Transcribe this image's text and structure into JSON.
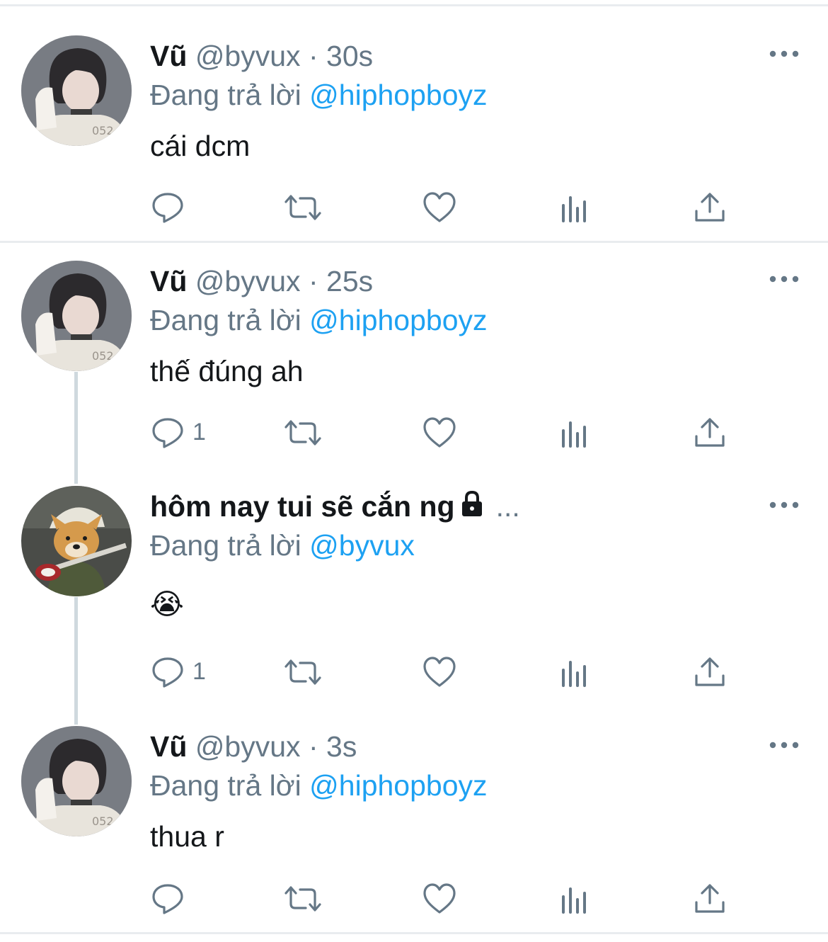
{
  "colors": {
    "accent": "#1da1f2",
    "secondary_text": "#657786",
    "primary_text": "#14171a",
    "divider": "#e9ecef",
    "thread_line": "#cfd9de"
  },
  "reply_prefix": "Đang trả lời",
  "tweets": [
    {
      "display_name": "Vũ",
      "handle": "@byvux",
      "separator": "·",
      "time": "30s",
      "reply_to": "@hiphopboyz",
      "text": "cái dcm",
      "reply_count": "",
      "avatar": "avatar-photo-person"
    },
    {
      "display_name": "Vũ",
      "handle": "@byvux",
      "separator": "·",
      "time": "25s",
      "reply_to": "@hiphopboyz",
      "text": "thế đúng ah",
      "reply_count": "1",
      "avatar": "avatar-photo-person"
    },
    {
      "display_name": "hôm nay tui sẽ cắn ng",
      "truncation": "...",
      "locked": true,
      "reply_to": "@byvux",
      "text": "😭",
      "reply_count": "1",
      "avatar": "avatar-photo-dog-guitar"
    },
    {
      "display_name": "Vũ",
      "handle": "@byvux",
      "separator": "·",
      "time": "3s",
      "reply_to": "@hiphopboyz",
      "text": "thua r",
      "reply_count": "",
      "avatar": "avatar-photo-person"
    }
  ],
  "action_icons": [
    "reply-icon",
    "retweet-icon",
    "like-icon",
    "analytics-icon",
    "share-icon"
  ]
}
